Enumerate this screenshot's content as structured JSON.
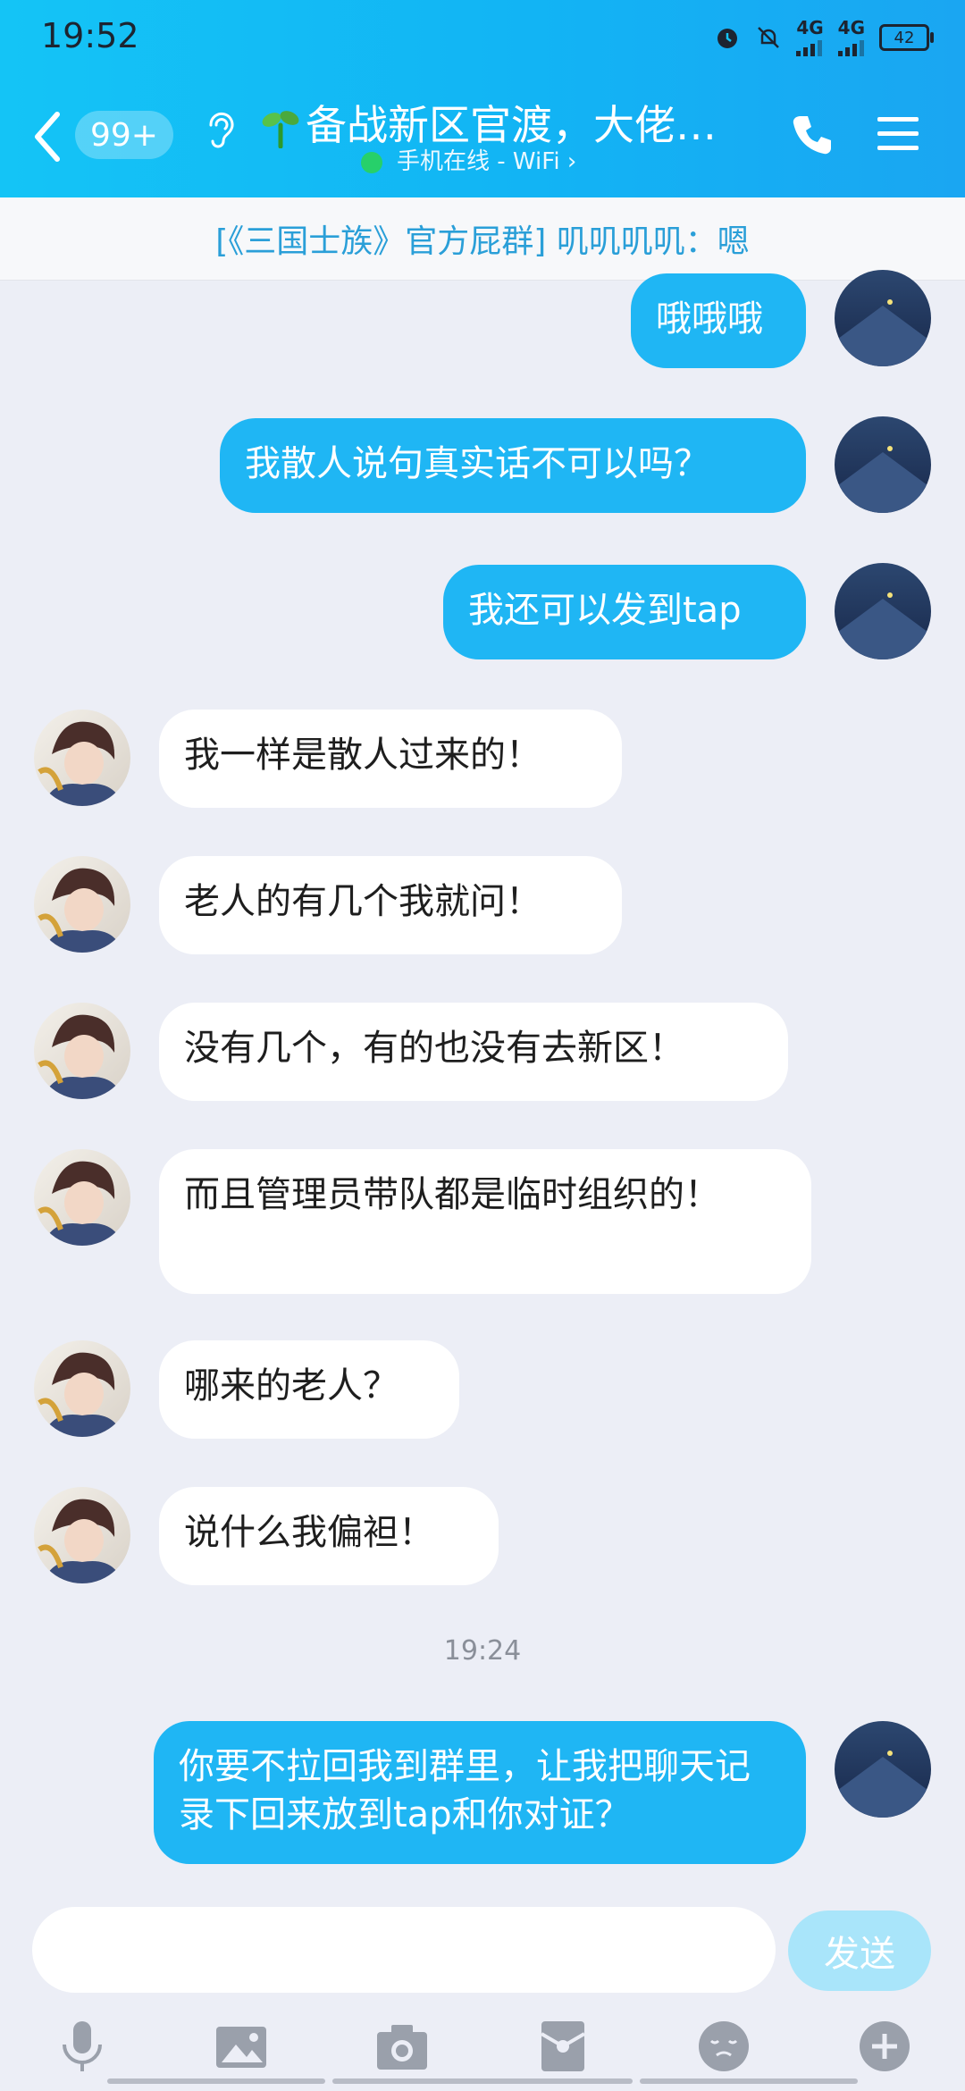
{
  "status_bar": {
    "time": "19:52",
    "network_1": "4G",
    "network_2": "4G",
    "battery": "42"
  },
  "header": {
    "unread_badge": "99+",
    "title": "备战新区官渡，大佬带…",
    "subtitle": "手机在线 - WiFi ›"
  },
  "notice": {
    "text": "[《三国士族》官方屁群] 叽叽叽叽：嗯"
  },
  "messages": [
    {
      "side": "out",
      "text": "哦哦哦"
    },
    {
      "side": "out",
      "text": "我散人说句真实话不可以吗？"
    },
    {
      "side": "out",
      "text": "我还可以发到tap"
    },
    {
      "side": "in",
      "text": "我一样是散人过来的！"
    },
    {
      "side": "in",
      "text": "老人的有几个我就问！"
    },
    {
      "side": "in",
      "text": "没有几个，有的也没有去新区！"
    },
    {
      "side": "in",
      "text": "而且管理员带队都是临时组织的！"
    },
    {
      "side": "in",
      "text": "哪来的老人？"
    },
    {
      "side": "in",
      "text": "说什么我偏袒！"
    },
    {
      "side": "out",
      "text": "你要不拉回我到群里，让我把聊天记录下回来放到tap和你对证？"
    }
  ],
  "timestamp": "19:24",
  "composer": {
    "input_value": "",
    "send_label": "发送"
  },
  "toolbar": {
    "icons": [
      "microphone-icon",
      "image-icon",
      "camera-icon",
      "red-packet-icon",
      "emoji-icon",
      "plus-icon"
    ]
  },
  "colors": {
    "header_start": "#14c4f6",
    "header_end": "#1aa6f2",
    "bubble_out": "#1fb6f4",
    "bubble_in": "#ffffff",
    "background": "#eceef6",
    "online": "#27d06a",
    "notice_text": "#2a9fd8"
  }
}
